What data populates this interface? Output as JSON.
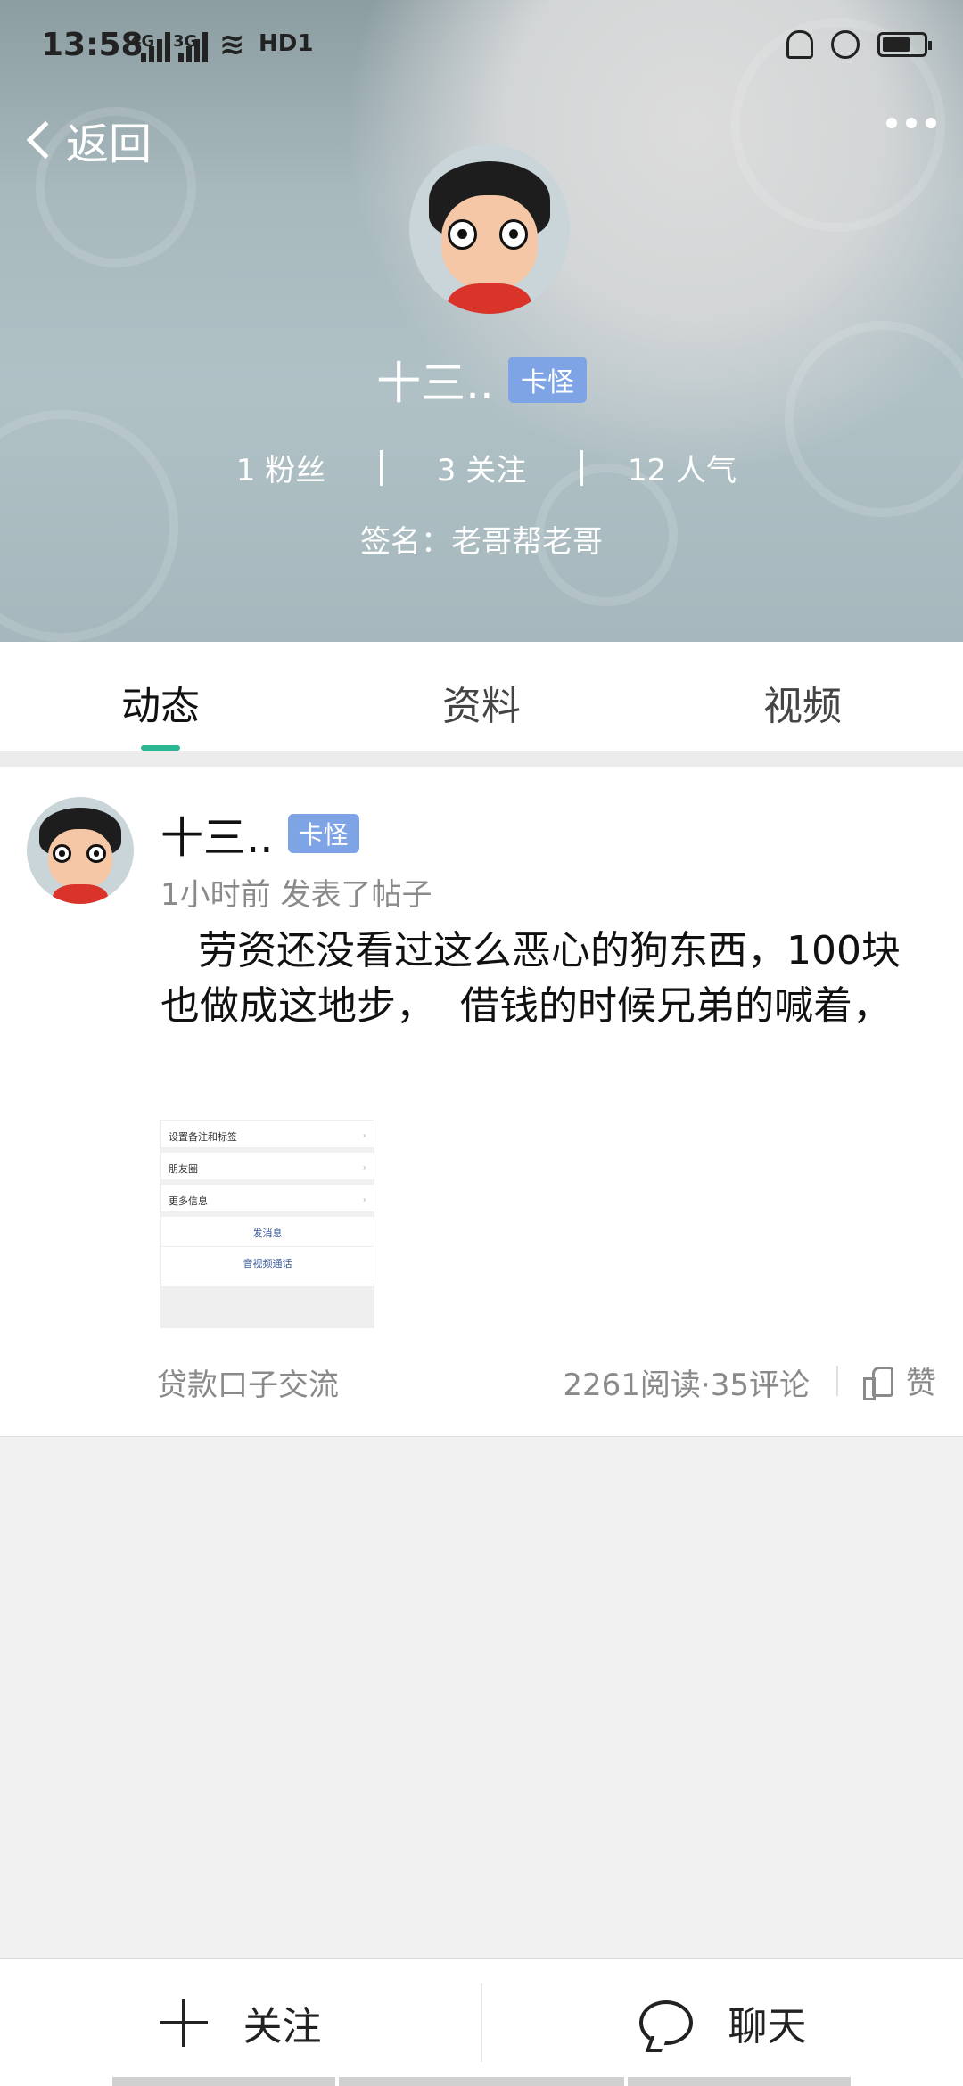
{
  "status_bar": {
    "time": "13:58",
    "signal_1": "4G",
    "signal_2": "3G",
    "hd": "HD1"
  },
  "header": {
    "back_label": "返回"
  },
  "profile": {
    "name": "十三..",
    "badge": "卡怪",
    "stats": [
      "1 粉丝",
      "3 关注",
      "12 人气"
    ],
    "signature": "签名：老哥帮老哥"
  },
  "tabs": [
    "动态",
    "资料",
    "视频"
  ],
  "active_tab": "动态",
  "post": {
    "author": "十三..",
    "badge": "卡怪",
    "meta": "1小时前  发表了帖子",
    "text": "   劳资还没看过这么恶心的狗东西，100块也做成这地步，  借钱的时候兄弟的喊着，",
    "thumbnail": {
      "rows": [
        "设置备注和标签",
        "朋友圈",
        "更多信息"
      ],
      "actions": [
        "发消息",
        "音视频通话"
      ]
    },
    "tag": "贷款口子交流",
    "stats": "2261阅读·35评论",
    "like_label": "赞"
  },
  "bottom_bar": {
    "follow_label": "关注",
    "chat_label": "聊天"
  }
}
